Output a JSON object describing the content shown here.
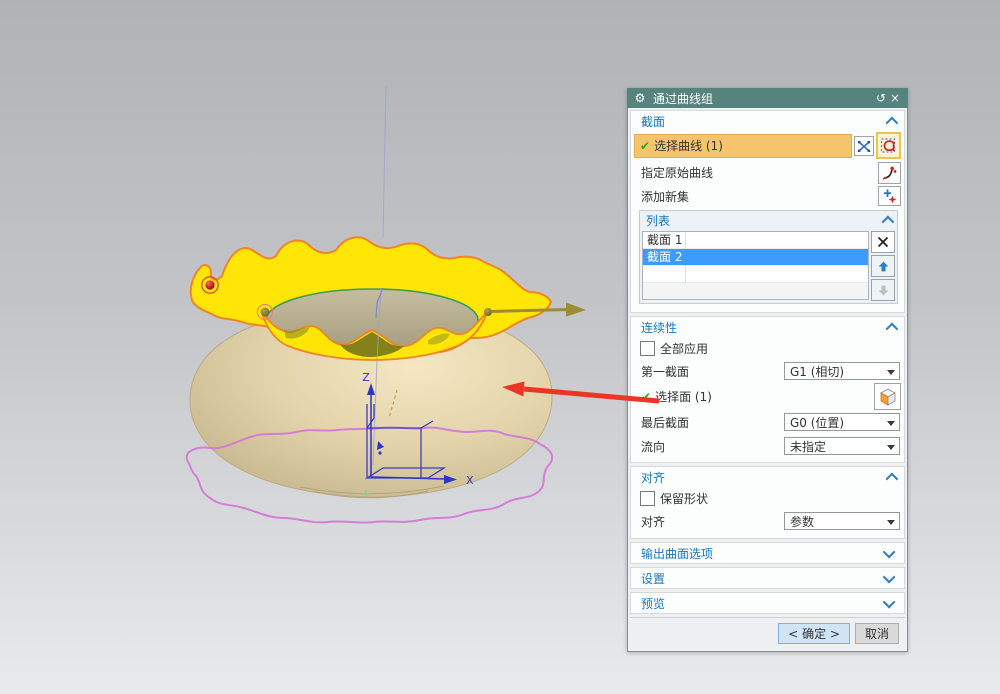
{
  "icons": {
    "gear": "⚙",
    "reset": "↺",
    "close": "×",
    "check": "✔"
  },
  "dialog": {
    "title": "通过曲线组",
    "section": {
      "header": "截面",
      "select_curve_label": "选择曲线 (1)",
      "specify_origin_curve_label": "指定原始曲线",
      "add_new_set_label": "添加新集",
      "list": {
        "header": "列表",
        "rows": [
          "截面 1",
          "截面 2"
        ]
      }
    },
    "continuity": {
      "header": "连续性",
      "apply_all_label": "全部应用",
      "first_section_label": "第一截面",
      "first_section_value": "G1 (相切)",
      "select_face_label": "选择面 (1)",
      "last_section_label": "最后截面",
      "last_section_value": "G0 (位置)",
      "flow_label": "流向",
      "flow_value": "未指定"
    },
    "alignment": {
      "header": "对齐",
      "preserve_shape_label": "保留形状",
      "align_label": "对齐",
      "align_value": "参数"
    },
    "collapsed": {
      "output_surface_options": "输出曲面选项",
      "settings": "设置",
      "preview": "预览"
    },
    "footer": {
      "ok_label": "< 确定 >",
      "cancel_label": "取消"
    }
  },
  "viewport": {
    "axis_z_label": "Z",
    "axis_x_label": "X"
  },
  "colors": {
    "titlebar": "#56837d",
    "section_header_text": "#1778be",
    "selected_field_orange": "#f6c46c",
    "list_selection_blue": "#3d9bfd",
    "surface_yellow": "#ffe606",
    "surface_outline_orange": "#f08428",
    "pot_tan": "#ddcfa6",
    "rim_curve_green": "#3a9e53",
    "bottom_curve_magenta": "#d678d8",
    "sketch_blue": "#3b3fc4",
    "annotation_arrow_red": "#ee3424"
  }
}
